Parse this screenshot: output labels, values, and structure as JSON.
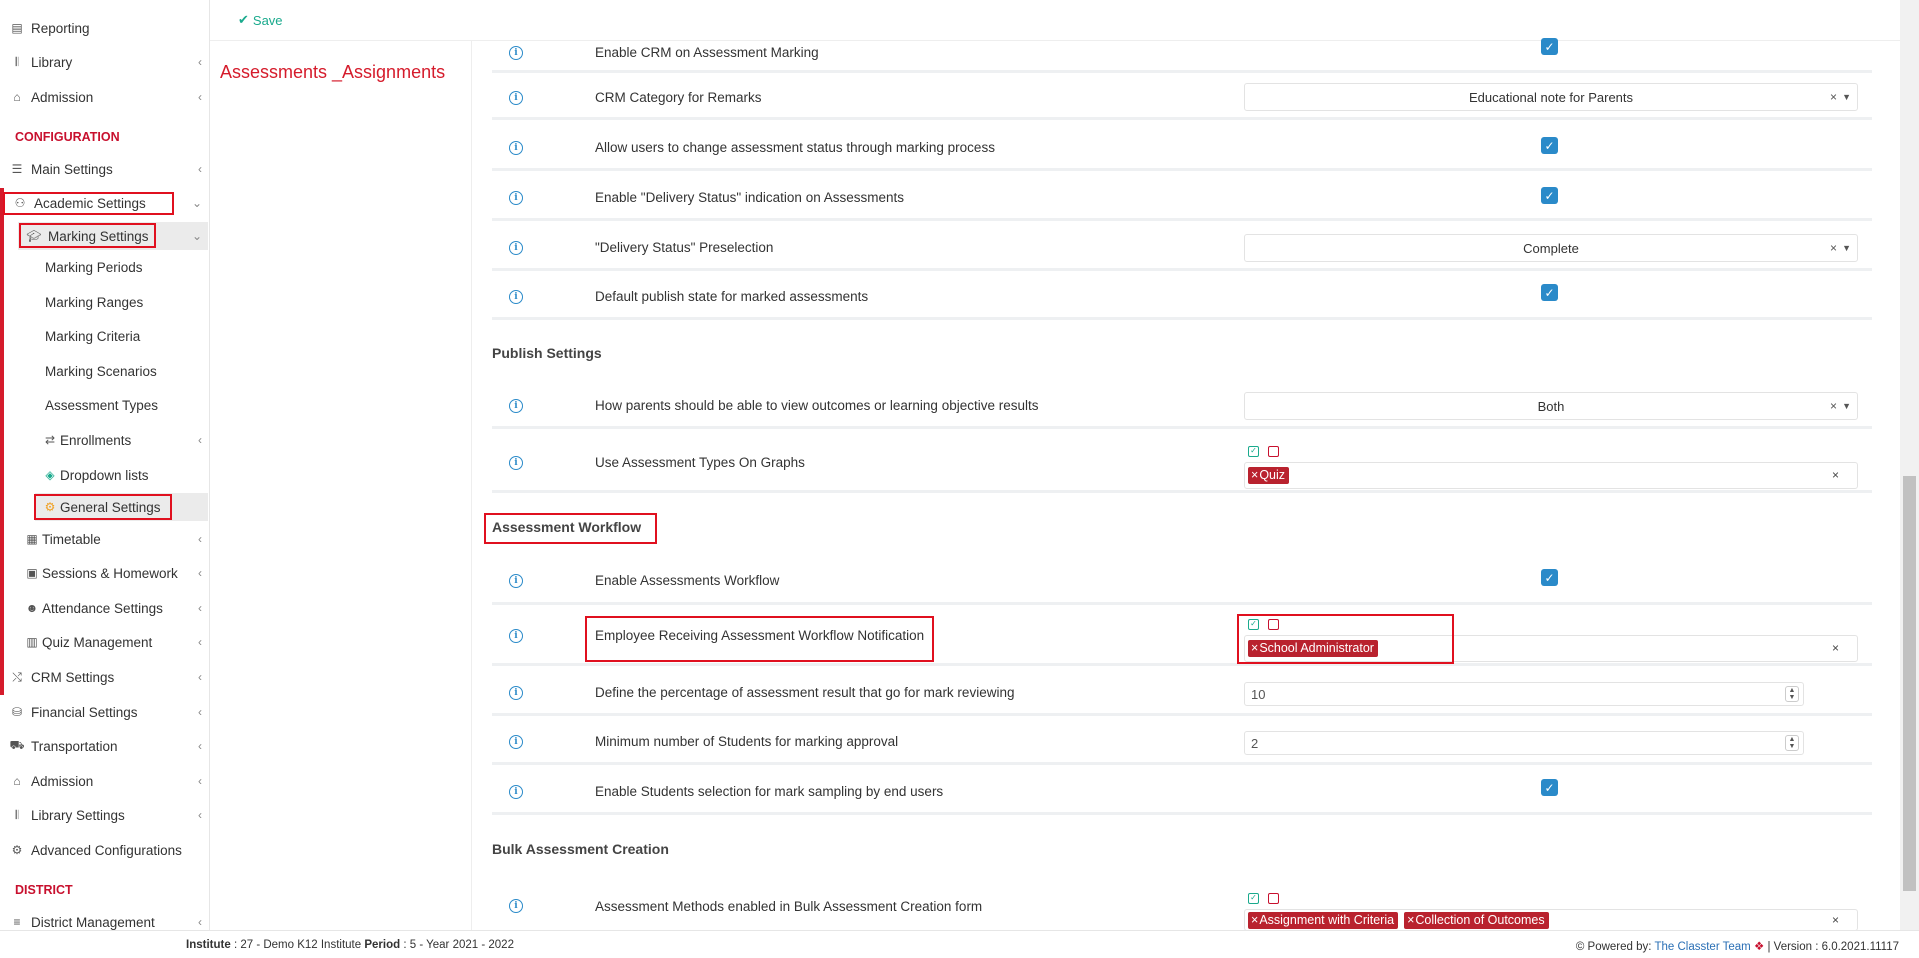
{
  "topbar": {
    "save_label": "Save"
  },
  "page_title": "Assessments _Assignments",
  "sidebar": {
    "items": [
      {
        "label": "Reporting",
        "icon": "report-icon",
        "chevron": false
      },
      {
        "label": "Library",
        "icon": "library-icon",
        "chevron": true
      },
      {
        "label": "Admission",
        "icon": "institution-icon",
        "chevron": true
      }
    ],
    "config_heading": "CONFIGURATION",
    "config_items": [
      {
        "label": "Main Settings",
        "icon": "sliders-icon",
        "chevron": true
      },
      {
        "label": "Academic Settings",
        "icon": "users-icon",
        "chevron": true
      },
      {
        "label": "Marking Settings",
        "icon": "graduation-cap-icon",
        "chevron": true
      },
      {
        "label": "Marking Periods"
      },
      {
        "label": "Marking Ranges"
      },
      {
        "label": "Marking Criteria"
      },
      {
        "label": "Marking Scenarios"
      },
      {
        "label": "Assessment Types"
      },
      {
        "label": "Enrollments",
        "icon": "exchange-icon",
        "chevron": true
      },
      {
        "label": "Dropdown lists",
        "icon": "layers-icon"
      },
      {
        "label": "General Settings",
        "icon": "cogs-icon"
      },
      {
        "label": "Timetable",
        "icon": "calendar-icon",
        "chevron": true
      },
      {
        "label": "Sessions & Homework",
        "icon": "teacher-icon",
        "chevron": true
      },
      {
        "label": "Attendance Settings",
        "icon": "user-check-icon",
        "chevron": true
      },
      {
        "label": "Quiz Management",
        "icon": "book-icon",
        "chevron": true
      },
      {
        "label": "CRM Settings",
        "icon": "shuffle-icon",
        "chevron": true
      },
      {
        "label": "Financial Settings",
        "icon": "database-icon",
        "chevron": true
      },
      {
        "label": "Transportation",
        "icon": "bus-icon",
        "chevron": true
      },
      {
        "label": "Admission",
        "icon": "institution-icon",
        "chevron": true
      },
      {
        "label": "Library Settings",
        "icon": "library-icon",
        "chevron": true
      },
      {
        "label": "Advanced Configurations",
        "icon": "cogs-icon",
        "chevron": false
      }
    ],
    "district_heading": "DISTRICT",
    "district_items": [
      {
        "label": "District Management",
        "icon": "bars-icon",
        "chevron": true
      }
    ]
  },
  "settings": {
    "rows_top": [
      {
        "label": "Enable CRM on Assessment Marking",
        "type": "checkbox",
        "checked": true
      },
      {
        "label": "CRM Category for Remarks",
        "type": "select",
        "value": "Educational note for Parents"
      },
      {
        "label": "Allow users to change assessment status through marking process",
        "type": "checkbox",
        "checked": true
      },
      {
        "label": "Enable \"Delivery Status\" indication on Assessments",
        "type": "checkbox",
        "checked": true
      },
      {
        "label": "\"Delivery Status\" Preselection",
        "type": "select",
        "value": "Complete"
      },
      {
        "label": "Default publish state for marked assessments",
        "type": "checkbox",
        "checked": true
      }
    ],
    "publish_heading": "Publish Settings",
    "publish_rows": [
      {
        "label": "How parents should be able to view outcomes or learning objective results",
        "type": "select",
        "value": "Both"
      },
      {
        "label": "Use Assessment Types On Graphs",
        "type": "multi",
        "tags": [
          "Quiz"
        ]
      }
    ],
    "workflow_heading": "Assessment Workflow",
    "workflow_rows": [
      {
        "label": "Enable Assessments Workflow",
        "type": "checkbox",
        "checked": true
      },
      {
        "label": "Employee Receiving Assessment Workflow Notification",
        "type": "multi",
        "tags": [
          "School Administrator"
        ]
      },
      {
        "label": "Define the percentage of assessment result that go for mark reviewing",
        "type": "number",
        "value": "10"
      },
      {
        "label": "Minimum number of Students for marking approval",
        "type": "number",
        "value": "2"
      },
      {
        "label": "Enable Students selection for mark sampling by end users",
        "type": "checkbox",
        "checked": true
      }
    ],
    "bulk_heading": "Bulk Assessment Creation",
    "bulk_rows": [
      {
        "label": "Assessment Methods enabled in Bulk Assessment Creation form",
        "type": "multi",
        "tags": [
          "Assignment with Criteria",
          "Collection of Outcomes"
        ]
      }
    ]
  },
  "footer": {
    "institute_label": "Institute",
    "institute_value": ": 27 - Demo K12 Institute",
    "period_label": "Period",
    "period_value": ": 5 - Year 2021 - 2022",
    "powered_by": "Powered by:",
    "team_link": "The Classter Team",
    "version": "| Version : 6.0.2021.11117"
  },
  "colors": {
    "accent_red": "#d51b2b",
    "checkbox_blue": "#2a8ac9",
    "save_green": "#1aaa8d",
    "tag_red": "#b9222e"
  }
}
